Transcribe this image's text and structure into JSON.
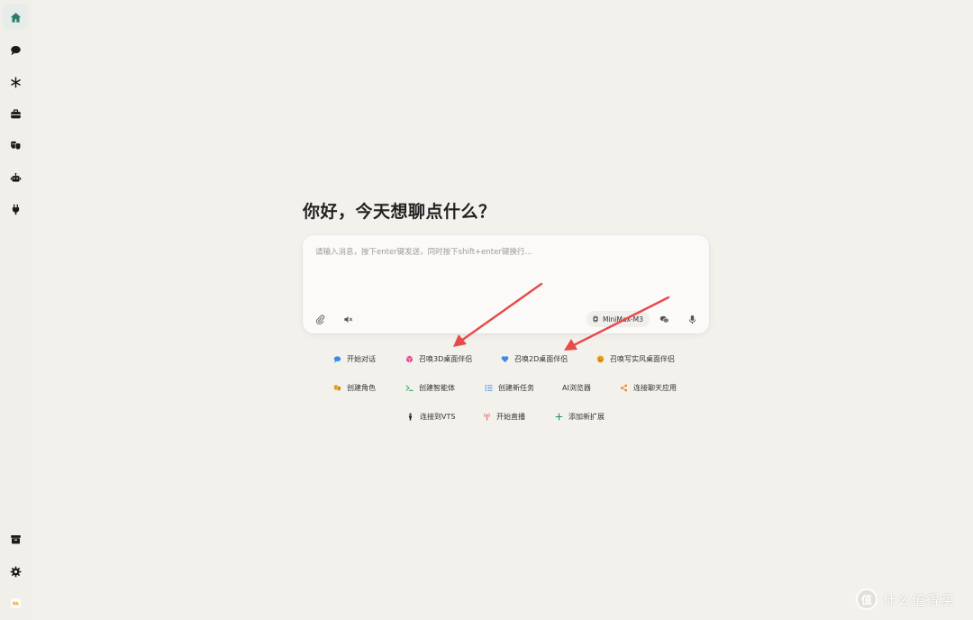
{
  "sidebar": {
    "top_items": [
      {
        "name": "home",
        "icon": "home-icon",
        "active": true
      },
      {
        "name": "chat",
        "icon": "chat-bubble-icon"
      },
      {
        "name": "snowflake",
        "icon": "snowflake-icon"
      },
      {
        "name": "toolbox",
        "icon": "toolbox-icon"
      },
      {
        "name": "masks",
        "icon": "theater-masks-icon"
      },
      {
        "name": "robot",
        "icon": "robot-icon"
      },
      {
        "name": "plug",
        "icon": "plug-icon"
      }
    ],
    "bottom_items": [
      {
        "name": "archive",
        "icon": "archive-icon"
      },
      {
        "name": "settings",
        "icon": "gear-icon"
      },
      {
        "name": "app-logo",
        "icon": "app-logo-icon"
      }
    ]
  },
  "main": {
    "greeting": "你好，今天想聊点什么？",
    "input_placeholder": "请输入消息，按下enter键发送，同时按下shift+enter键换行...",
    "model_name": "MiniMax-M3"
  },
  "actions": {
    "row1": [
      {
        "label": "开始对话",
        "icon": "chat-bubble-icon",
        "color": "#3b8be6"
      },
      {
        "label": "召唤3D桌面伴侣",
        "icon": "cube-icon",
        "color": "#e34c8c"
      },
      {
        "label": "召唤2D桌面伴侣",
        "icon": "heart-icon",
        "color": "#3b8be6"
      },
      {
        "label": "召唤写实风桌面伴侣",
        "icon": "face-icon",
        "color": "#f0a020"
      }
    ],
    "row2": [
      {
        "label": "创建角色",
        "icon": "theater-masks-icon",
        "color": "#e0a020"
      },
      {
        "label": "创建智能体",
        "icon": "terminal-icon",
        "color": "#27a86a"
      },
      {
        "label": "创建新任务",
        "icon": "list-icon",
        "color": "#3b8be6"
      },
      {
        "label": "AI浏览器",
        "icon": "",
        "color": "#333333"
      },
      {
        "label": "连接聊天应用",
        "icon": "share-icon",
        "color": "#f08020"
      }
    ],
    "row3": [
      {
        "label": "连接到VTS",
        "icon": "person-icon",
        "color": "#333333"
      },
      {
        "label": "开始直播",
        "icon": "broadcast-icon",
        "color": "#e34c4c"
      },
      {
        "label": "添加新扩展",
        "icon": "plus-icon",
        "color": "#1f8a6a"
      }
    ]
  },
  "watermark": {
    "logo": "值",
    "text": "什么值得买"
  },
  "colors": {
    "accent": "#2e7d6b",
    "annotation_arrow": "#e84a4a"
  }
}
